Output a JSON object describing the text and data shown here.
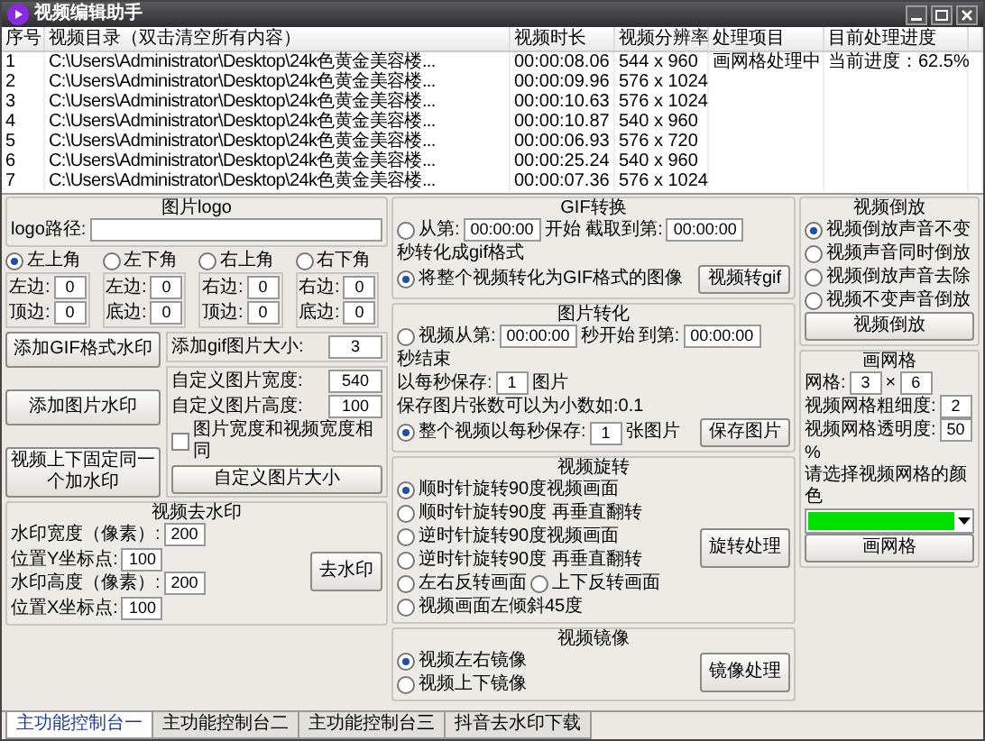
{
  "window": {
    "title": "视频编辑助手"
  },
  "table": {
    "columns": [
      "序号",
      "视频目录（双击清空所有内容）",
      "视频时长",
      "视频分辨率",
      "处理项目",
      "目前处理进度"
    ],
    "rows": [
      {
        "index": "1",
        "path": "C:\\Users\\Administrator\\Desktop\\24k色黄金美容楼...",
        "duration": "00:00:08.06",
        "resolution": "544 x 960",
        "task": "画网格处理中",
        "progress": "当前进度：62.5%"
      },
      {
        "index": "2",
        "path": "C:\\Users\\Administrator\\Desktop\\24k色黄金美容楼...",
        "duration": "00:00:09.96",
        "resolution": "576 x 1024"
      },
      {
        "index": "3",
        "path": "C:\\Users\\Administrator\\Desktop\\24k色黄金美容楼...",
        "duration": "00:00:10.63",
        "resolution": "576 x 1024"
      },
      {
        "index": "4",
        "path": "C:\\Users\\Administrator\\Desktop\\24k色黄金美容楼...",
        "duration": "00:00:10.87",
        "resolution": "540 x 960"
      },
      {
        "index": "5",
        "path": "C:\\Users\\Administrator\\Desktop\\24k色黄金美容楼...",
        "duration": "00:00:06.93",
        "resolution": "576 x 720"
      },
      {
        "index": "6",
        "path": "C:\\Users\\Administrator\\Desktop\\24k色黄金美容楼...",
        "duration": "00:00:25.24",
        "resolution": "540 x 960"
      },
      {
        "index": "7",
        "path": "C:\\Users\\Administrator\\Desktop\\24k色黄金美容楼...",
        "duration": "00:00:07.36",
        "resolution": "576 x 1024"
      }
    ]
  },
  "logo": {
    "title": "图片logo",
    "path_label": "logo路径:",
    "corners": [
      {
        "label": "左上角",
        "selected": true,
        "fields": [
          {
            "label": "左边:",
            "value": "0"
          },
          {
            "label": "顶边:",
            "value": "0"
          }
        ]
      },
      {
        "label": "左下角",
        "selected": false,
        "fields": [
          {
            "label": "左边:",
            "value": "0"
          },
          {
            "label": "底边:",
            "value": "0"
          }
        ]
      },
      {
        "label": "右上角",
        "selected": false,
        "fields": [
          {
            "label": "右边:",
            "value": "0"
          },
          {
            "label": "顶边:",
            "value": "0"
          }
        ]
      },
      {
        "label": "右下角",
        "selected": false,
        "fields": [
          {
            "label": "右边:",
            "value": "0"
          },
          {
            "label": "底边:",
            "value": "0"
          }
        ]
      }
    ],
    "buttons": [
      "添加GIF格式水印",
      "添加图片水印",
      "视频上下固定同一个加水印"
    ],
    "gif_size": {
      "label": "添加gif图片大小:",
      "value": "3"
    },
    "custom": {
      "fields": [
        {
          "label": "自定义图片宽度:",
          "value": "540"
        },
        {
          "label": "自定义图片高度:",
          "value": "100"
        }
      ],
      "same_width": {
        "label": "图片宽度和视频宽度相同",
        "checked": false
      },
      "button": "自定义图片大小"
    }
  },
  "remove": {
    "title": "视频去水印",
    "rows": [
      {
        "items": [
          {
            "kind": "text",
            "text": "水印宽度（像素）:"
          },
          {
            "kind": "input",
            "value": "200"
          },
          {
            "kind": "text",
            "text": "位置Y坐标点:"
          },
          {
            "kind": "input",
            "value": "100"
          }
        ]
      },
      {
        "items": [
          {
            "kind": "text",
            "text": "水印高度（像素）:"
          },
          {
            "kind": "input",
            "value": "200"
          },
          {
            "kind": "text",
            "text": "位置X坐标点:"
          },
          {
            "kind": "input",
            "value": "100"
          }
        ]
      }
    ],
    "button": "去水印"
  },
  "middle": [
    {
      "title": "GIF转换",
      "rows": [
        {
          "items": [
            {
              "kind": "radio",
              "label": "从第:",
              "selected": false
            },
            {
              "kind": "input",
              "value": "00:00:00"
            },
            {
              "kind": "text",
              "text": "开始 截取到第:"
            },
            {
              "kind": "input",
              "value": "00:00:00"
            },
            {
              "kind": "text",
              "text": "秒转化成gif格式"
            }
          ]
        },
        {
          "items": [
            {
              "kind": "radio",
              "label": "将整个视频转化为GIF格式的图像",
              "selected": true
            },
            {
              "kind": "button",
              "label": "视频转gif"
            }
          ]
        }
      ]
    },
    {
      "title": "图片转化",
      "rows": [
        {
          "items": [
            {
              "kind": "radio",
              "label": "视频从第:",
              "selected": false
            },
            {
              "kind": "input",
              "value": "00:00:00"
            },
            {
              "kind": "text",
              "text": "秒开始"
            },
            {
              "kind": "text",
              "text": "到第:"
            },
            {
              "kind": "input",
              "value": "00:00:00"
            },
            {
              "kind": "text",
              "text": "秒结束"
            }
          ]
        },
        {
          "items": [
            {
              "kind": "text",
              "text": "以每秒保存:"
            },
            {
              "kind": "input",
              "value": "1"
            },
            {
              "kind": "text",
              "text": "图片"
            },
            {
              "kind": "text",
              "text": "保存图片张数可以为小数如:0.1"
            }
          ]
        },
        {
          "items": [
            {
              "kind": "radio",
              "label": "整个视频以每秒保存:",
              "selected": true
            },
            {
              "kind": "input",
              "value": "1"
            },
            {
              "kind": "text",
              "text": "张图片"
            },
            {
              "kind": "button",
              "label": "保存图片"
            }
          ]
        }
      ]
    },
    {
      "title": "视频旋转",
      "rows": [
        {
          "items": [
            {
              "kind": "radio",
              "label": "顺时针旋转90度视频画面",
              "selected": true
            }
          ]
        },
        {
          "items": [
            {
              "kind": "radio",
              "label": "顺时针旋转90度 再垂直翻转",
              "selected": false
            }
          ]
        },
        {
          "items": [
            {
              "kind": "radio",
              "label": "逆时针旋转90度视频画面",
              "selected": false
            }
          ]
        },
        {
          "items": [
            {
              "kind": "radio",
              "label": "逆时针旋转90度 再垂直翻转",
              "selected": false
            }
          ]
        },
        {
          "items": [
            {
              "kind": "radio",
              "label": "左右反转画面",
              "selected": false
            },
            {
              "kind": "radio",
              "label": "上下反转画面",
              "selected": false
            }
          ]
        },
        {
          "items": [
            {
              "kind": "radio",
              "label": "视频画面左倾斜45度",
              "selected": false
            }
          ]
        }
      ],
      "button": "旋转处理"
    },
    {
      "title": "视频镜像",
      "rows": [
        {
          "items": [
            {
              "kind": "radio",
              "label": "视频左右镜像",
              "selected": true
            }
          ]
        },
        {
          "items": [
            {
              "kind": "radio",
              "label": "视频上下镜像",
              "selected": false
            }
          ]
        }
      ],
      "button": "镜像处理"
    }
  ],
  "right": [
    {
      "title": "视频倒放",
      "rows": [
        {
          "items": [
            {
              "kind": "radio",
              "label": "视频倒放声音不变",
              "selected": true
            }
          ]
        },
        {
          "items": [
            {
              "kind": "radio",
              "label": "视频声音同时倒放",
              "selected": false
            }
          ]
        },
        {
          "items": [
            {
              "kind": "radio",
              "label": "视频倒放声音去除",
              "selected": false
            }
          ]
        },
        {
          "items": [
            {
              "kind": "radio",
              "label": "视频不变声音倒放",
              "selected": false
            }
          ]
        },
        {
          "items": [
            {
              "kind": "button",
              "label": "视频倒放"
            }
          ]
        }
      ]
    },
    {
      "title": "画网格",
      "rows": [
        {
          "items": [
            {
              "kind": "text",
              "text": "网格:"
            },
            {
              "kind": "input",
              "value": "3"
            },
            {
              "kind": "text",
              "text": "×"
            },
            {
              "kind": "input",
              "value": "6"
            }
          ]
        },
        {
          "items": [
            {
              "kind": "text",
              "text": "视频网格粗细度:"
            },
            {
              "kind": "input",
              "value": "2"
            }
          ]
        },
        {
          "items": [
            {
              "kind": "text",
              "text": "视频网格透明度:"
            },
            {
              "kind": "input",
              "value": "50"
            },
            {
              "kind": "text",
              "text": "%"
            }
          ]
        },
        {
          "items": [
            {
              "kind": "text",
              "text": "请选择视频网格的颜色"
            }
          ]
        },
        {
          "items": [
            {
              "kind": "color",
              "color": "#00e000"
            }
          ]
        },
        {
          "items": [
            {
              "kind": "button",
              "label": "画网格"
            }
          ]
        }
      ]
    }
  ],
  "tabs": [
    {
      "label": "主功能控制台一",
      "selected": true
    },
    {
      "label": "主功能控制台二",
      "selected": false
    },
    {
      "label": "主功能控制台三",
      "selected": false
    },
    {
      "label": "抖音去水印下载",
      "selected": false
    }
  ]
}
